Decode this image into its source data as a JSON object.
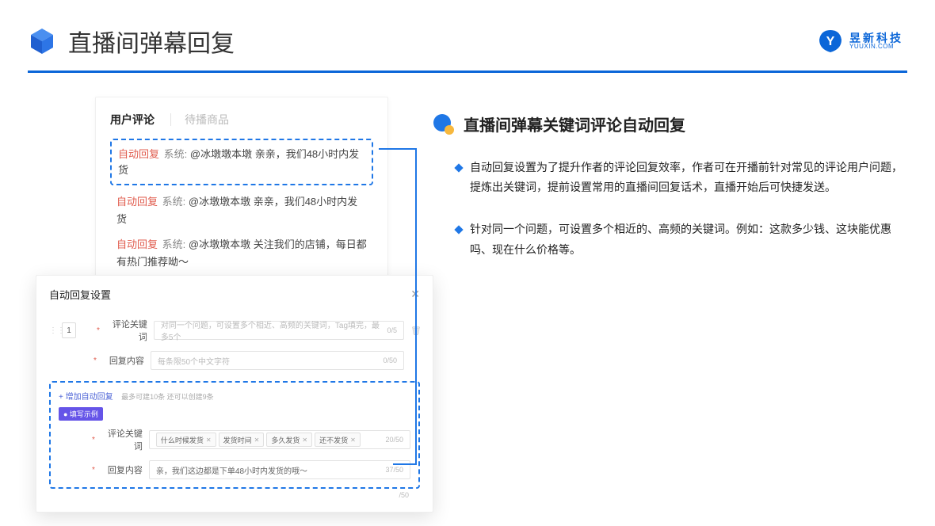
{
  "header": {
    "title": "直播间弹幕回复",
    "brand_cn": "昱新科技",
    "brand_en": "YUUXIN.COM"
  },
  "comments": {
    "tab_active": "用户评论",
    "tab_other": "待播商品",
    "auto_badge": "自动回复",
    "system_label": "系统:",
    "highlight_msg": "@冰墩墩本墩 亲亲，我们48小时内发货",
    "line2": "@冰墩墩本墩 亲亲，我们48小时内发货",
    "line3": "@冰墩墩本墩 关注我们的店铺，每日都有热门推荐呦～"
  },
  "settings": {
    "title": "自动回复设置",
    "row_num": "1",
    "kw_label": "评论关键词",
    "kw_placeholder": "对同一个问题，可设置多个相近、高频的关键词，Tag填完，最多5个",
    "kw_count": "0/5",
    "reply_label": "回复内容",
    "reply_placeholder": "每条限50个中文字符",
    "reply_count": "0/50",
    "add_label": "+ 增加自动回复",
    "add_hint": "最多可建10条 还可以创建9条",
    "example_badge": "● 填写示例",
    "ex_kw_label": "评论关键词",
    "ex_tags": [
      "什么时候发货",
      "发货时间",
      "多久发货",
      "还不发货"
    ],
    "ex_kw_count": "20/50",
    "ex_reply_label": "回复内容",
    "ex_reply_val": "亲，我们这边都是下单48小时内发货的哦～",
    "ex_reply_count": "37/50",
    "outer_count": "/50"
  },
  "right": {
    "section_title": "直播间弹幕关键词评论自动回复",
    "bullet1": "自动回复设置为了提升作者的评论回复效率，作者可在开播前针对常见的评论用户问题，提炼出关键词，提前设置常用的直播间回复话术，直播开始后可快捷发送。",
    "bullet2": "针对同一个问题，可设置多个相近的、高频的关键词。例如：这款多少钱、这块能优惠吗、现在什么价格等。"
  }
}
